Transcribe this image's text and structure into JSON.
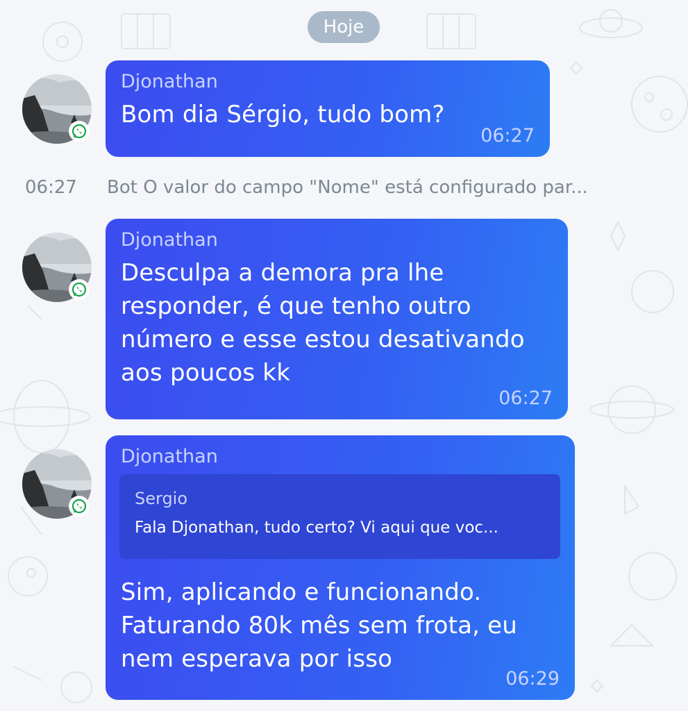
{
  "date_divider": "Hoje",
  "system_message": {
    "time": "06:27",
    "text": "Bot O valor do campo \"Nome\" está configurado par..."
  },
  "messages": [
    {
      "sender": "Djonathan",
      "text": "Bom dia Sérgio, tudo bom?",
      "time": "06:27"
    },
    {
      "sender": "Djonathan",
      "lines": [
        "Desculpa a demora pra lhe",
        "responder, é que tenho outro",
        "número e esse estou desativando",
        "aos poucos kk"
      ],
      "time": "06:27"
    },
    {
      "sender": "Djonathan",
      "quote": {
        "sender": "Sergio",
        "text": "Fala Djonathan, tudo certo? Vi aqui que voc..."
      },
      "lines": [
        "Sim, aplicando e funcionando.",
        "Faturando 80k mês sem frota, eu",
        "nem esperava por isso"
      ],
      "time": "06:29"
    }
  ],
  "colors": {
    "bubble": "#3460f3",
    "date_pill": "#a9b9c9",
    "background": "#f4f6f9",
    "whatsapp": "#25d366"
  },
  "icons": {
    "avatar": "landscape-avatar",
    "channel_badge": "whatsapp-icon"
  }
}
